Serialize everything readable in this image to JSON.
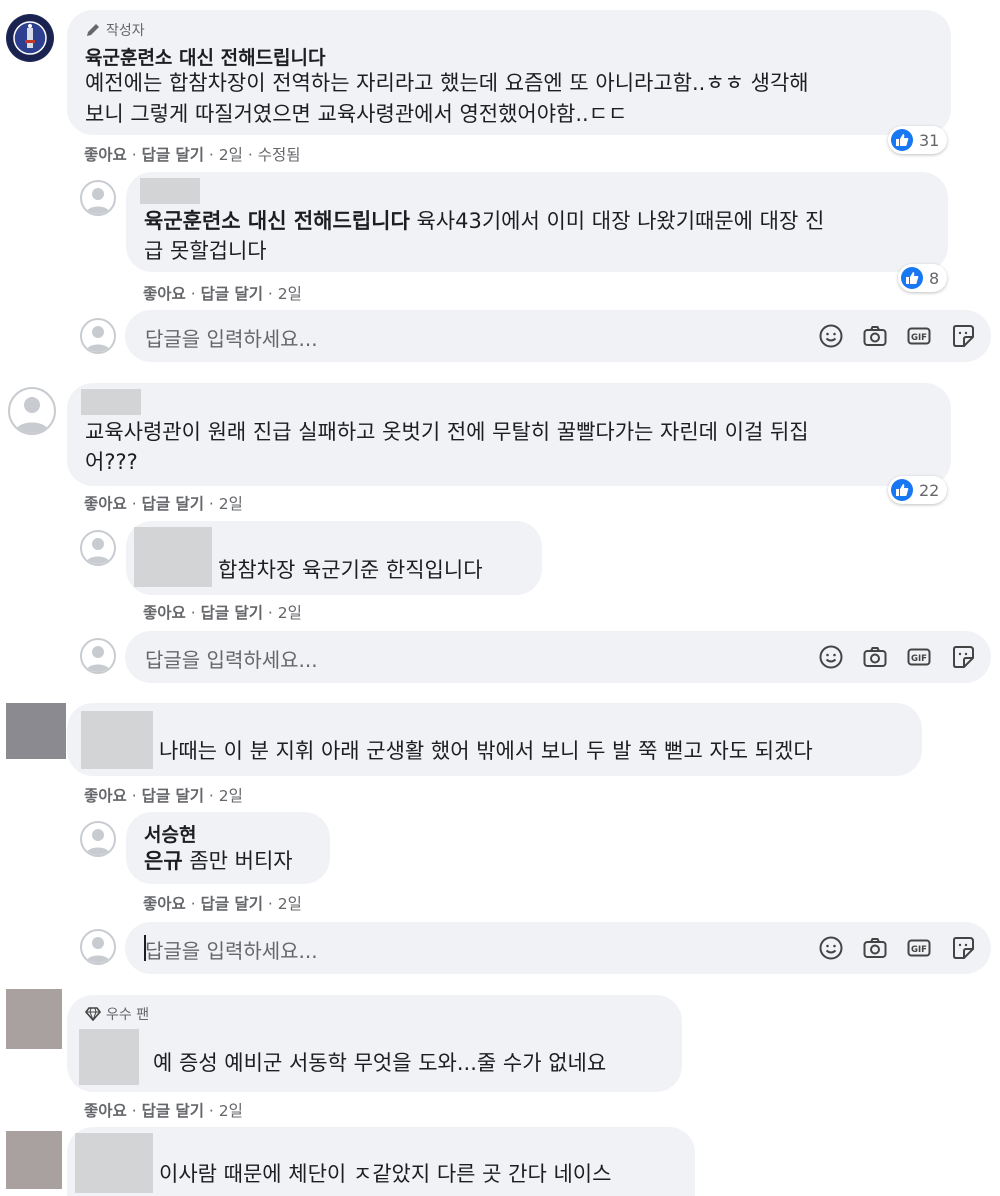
{
  "comments": [
    {
      "badge": "작성자",
      "author": "육군훈련소 대신 전해드립니다",
      "text_line1": "예전에는 합참차장이 전역하는 자리라고 했는데 요즘엔 또 아니라고함..ㅎㅎ 생각해",
      "text_line2": "보니 그렇게 따질거였으면 교육사령관에서 영전했어야함..ㄷㄷ",
      "actions": {
        "like": "좋아요",
        "reply": "답글 달기",
        "time": "2일",
        "edited": "수정됨"
      },
      "reactions": "31",
      "replies": [
        {
          "mention": "육군훈련소 대신 전해드립니다",
          "text_line1_rest": " 육사43기에서 이미 대장 나왔기때문에 대장 진",
          "text_line2": "급 못할겁니다",
          "actions": {
            "like": "좋아요",
            "reply": "답글 달기",
            "time": "2일"
          },
          "reactions": "8"
        }
      ]
    },
    {
      "text_line1": "교육사령관이 원래 진급 실패하고 옷벗기 전에 무탈히 꿀빨다가는 자린데 이걸 뒤집",
      "text_line2": "어???",
      "actions": {
        "like": "좋아요",
        "reply": "답글 달기",
        "time": "2일"
      },
      "reactions": "22",
      "replies": [
        {
          "text": "합참차장 육군기준 한직입니다",
          "actions": {
            "like": "좋아요",
            "reply": "답글 달기",
            "time": "2일"
          }
        }
      ]
    },
    {
      "text": "나때는 이 분 지휘 아래 군생활 했어 밖에서 보니 두 발 쭉 뻗고 자도 되겠다",
      "actions": {
        "like": "좋아요",
        "reply": "답글 달기",
        "time": "2일"
      },
      "replies": [
        {
          "author": "서승현",
          "mention": "은규",
          "text_rest": " 좀만 버티자",
          "actions": {
            "like": "좋아요",
            "reply": "답글 달기",
            "time": "2일"
          }
        }
      ]
    },
    {
      "badge": "우수 팬",
      "text": "예 증성 예비군 서동학 무엇을 도와...줄 수가 없네요",
      "actions": {
        "like": "좋아요",
        "reply": "답글 달기",
        "time": "2일"
      }
    },
    {
      "text": "이사람 때문에 체단이 ㅈ같았지 다른 곳 간다 네이스"
    }
  ],
  "reply_input": {
    "placeholder": "답글을 입력하세요..."
  },
  "icons": {
    "emoji": "smile-icon",
    "camera": "camera-icon",
    "gif": "gif-icon",
    "sticker": "sticker-icon",
    "like": "like-icon",
    "pencil": "pencil-icon",
    "diamond": "diamond-icon"
  },
  "colors": {
    "like_blue": "#1877f2",
    "bubble_bg": "#f0f2f5",
    "meta_gray": "#65676b"
  }
}
